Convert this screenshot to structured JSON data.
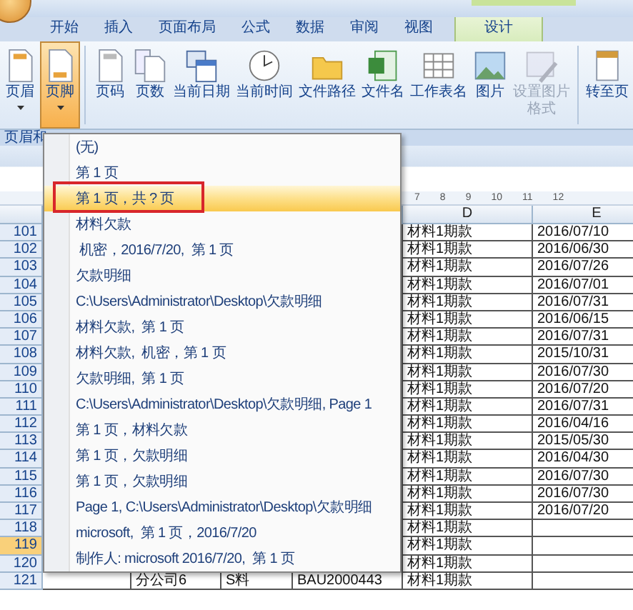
{
  "tabs": [
    {
      "label": "开始",
      "selected": false
    },
    {
      "label": "插入",
      "selected": false
    },
    {
      "label": "页面布局",
      "selected": false
    },
    {
      "label": "公式",
      "selected": false
    },
    {
      "label": "数据",
      "selected": false
    },
    {
      "label": "审阅",
      "selected": false
    },
    {
      "label": "视图",
      "selected": false
    },
    {
      "label": "设计",
      "selected": true
    }
  ],
  "ribbon": {
    "buttons": [
      {
        "label": "页眉",
        "kind": "header",
        "dropdown": true,
        "pressed": false,
        "disabled": false
      },
      {
        "label": "页脚",
        "kind": "footer",
        "dropdown": true,
        "pressed": true,
        "disabled": false
      },
      {
        "label": "页码",
        "kind": "page-number",
        "dropdown": false,
        "pressed": false,
        "disabled": false
      },
      {
        "label": "页数",
        "kind": "page-count",
        "dropdown": false,
        "pressed": false,
        "disabled": false
      },
      {
        "label": "当前日期",
        "kind": "date",
        "dropdown": false,
        "pressed": false,
        "disabled": false
      },
      {
        "label": "当前时间",
        "kind": "time",
        "dropdown": false,
        "pressed": false,
        "disabled": false
      },
      {
        "label": "文件路径",
        "kind": "folder",
        "dropdown": false,
        "pressed": false,
        "disabled": false
      },
      {
        "label": "文件名",
        "kind": "file",
        "dropdown": false,
        "pressed": false,
        "disabled": false
      },
      {
        "label": "工作表名",
        "kind": "sheet",
        "dropdown": false,
        "pressed": false,
        "disabled": false
      },
      {
        "label": "图片",
        "kind": "picture",
        "dropdown": false,
        "pressed": false,
        "disabled": false
      },
      {
        "label": "设置图片格式",
        "kind": "format",
        "dropdown": false,
        "pressed": false,
        "disabled": true
      },
      {
        "label": "转至页",
        "kind": "goto",
        "dropdown": false,
        "pressed": false,
        "disabled": false
      }
    ],
    "group_label": "页眉和"
  },
  "ruler": [
    "7",
    "8",
    "9",
    "10",
    "11",
    "12"
  ],
  "columns": [
    "D",
    "E"
  ],
  "rows": [
    {
      "number": "101",
      "d": "材料1期款",
      "e": "2016/07/10",
      "selected": false
    },
    {
      "number": "102",
      "d": "材料1期款",
      "e": "2016/06/30",
      "selected": false
    },
    {
      "number": "103",
      "d": "材料1期款",
      "e": "2016/07/26",
      "selected": false
    },
    {
      "number": "104",
      "d": "材料1期款",
      "e": "2016/07/01",
      "selected": false
    },
    {
      "number": "105",
      "d": "材料1期款",
      "e": "2016/07/31",
      "selected": false
    },
    {
      "number": "106",
      "d": "材料1期款",
      "e": "2016/06/15",
      "selected": false
    },
    {
      "number": "107",
      "d": "材料1期款",
      "e": "2016/07/31",
      "selected": false
    },
    {
      "number": "108",
      "d": "材料1期款",
      "e": "2015/10/31",
      "selected": false
    },
    {
      "number": "109",
      "d": "材料1期款",
      "e": "2016/07/30",
      "selected": false
    },
    {
      "number": "110",
      "d": "材料1期款",
      "e": "2016/07/20",
      "selected": false
    },
    {
      "number": "111",
      "d": "材料1期款",
      "e": "2016/07/31",
      "selected": false
    },
    {
      "number": "112",
      "d": "材料1期款",
      "e": "2016/04/16",
      "selected": false
    },
    {
      "number": "113",
      "d": "材料1期款",
      "e": "2015/05/30",
      "selected": false
    },
    {
      "number": "114",
      "d": "材料1期款",
      "e": "2016/04/30",
      "selected": false
    },
    {
      "number": "115",
      "d": "材料1期款",
      "e": "2016/07/30",
      "selected": false
    },
    {
      "number": "116",
      "d": "材料1期款",
      "e": "2016/07/30",
      "selected": false
    },
    {
      "number": "117",
      "d": "材料1期款",
      "e": "2016/07/20",
      "selected": false
    },
    {
      "number": "118",
      "d": "材料1期款",
      "selected": false
    },
    {
      "number": "119",
      "d": "材料1期款",
      "selected": true
    },
    {
      "number": "120",
      "d": "材料1期款",
      "selected": false
    },
    {
      "number": "121",
      "left": [
        "分公司6",
        "S料",
        "BAU2000443"
      ],
      "d": "材料1期款",
      "selected": false
    }
  ],
  "menu": {
    "items": [
      {
        "label": "(无)",
        "selected": false
      },
      {
        "label": "第 1 页",
        "selected": false
      },
      {
        "label": "第 1 页，共 ? 页",
        "selected": true,
        "framed": true
      },
      {
        "label": "材料欠款",
        "selected": false
      },
      {
        "label": " 机密，2016/7/20,  第 1 页",
        "selected": false
      },
      {
        "label": "欠款明细",
        "selected": false
      },
      {
        "label": "C:\\Users\\Administrator\\Desktop\\欠款明细",
        "selected": false
      },
      {
        "label": "材料欠款,  第 1 页",
        "selected": false
      },
      {
        "label": "材料欠款,  机密，第 1 页",
        "selected": false
      },
      {
        "label": "欠款明细,  第 1 页",
        "selected": false
      },
      {
        "label": "C:\\Users\\Administrator\\Desktop\\欠款明细, Page 1",
        "selected": false
      },
      {
        "label": "第 1 页，材料欠款",
        "selected": false
      },
      {
        "label": "第 1 页，欠款明细",
        "selected": false
      },
      {
        "label": "第 1 页，欠款明细",
        "selected": false
      },
      {
        "label": "Page 1, C:\\Users\\Administrator\\Desktop\\欠款明细",
        "selected": false
      },
      {
        "label": "microsoft,  第 1 页，2016/7/20",
        "selected": false
      },
      {
        "label": "制作人: microsoft 2016/7/20,  第 1 页",
        "selected": false
      }
    ]
  }
}
